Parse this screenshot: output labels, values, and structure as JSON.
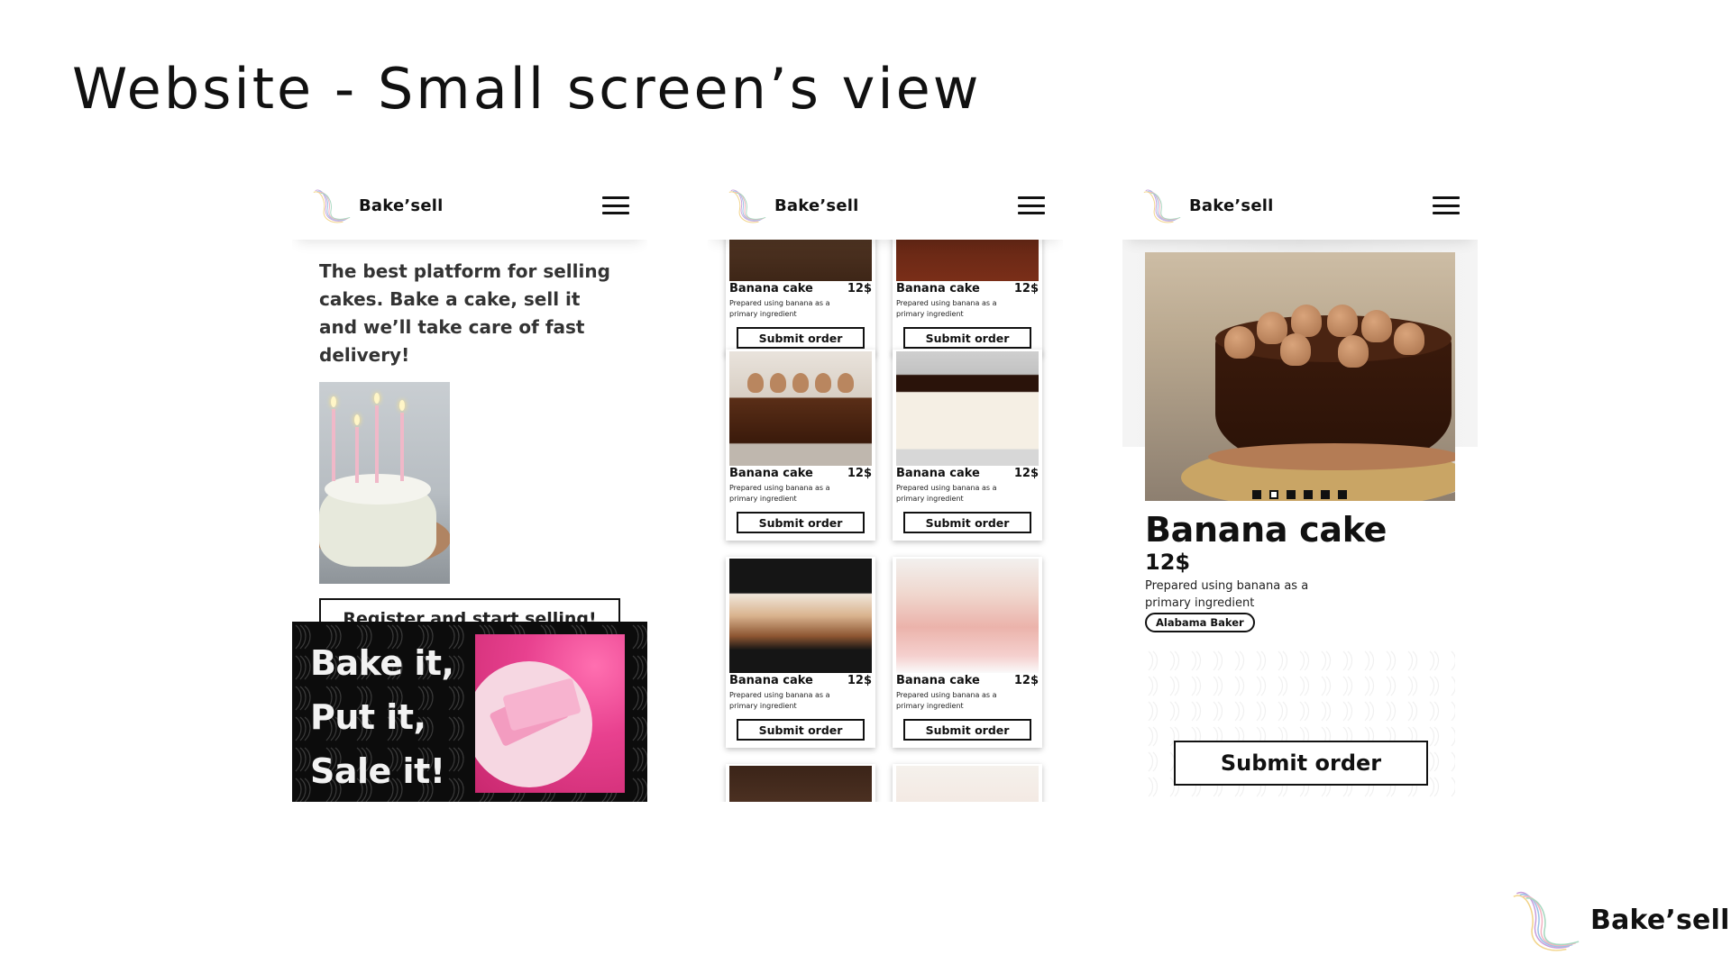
{
  "slide": {
    "title": "Website - Small screen’s view"
  },
  "brand": {
    "name": "Bake’sell",
    "logo_icon": "wave-logo-icon",
    "menu_icon": "hamburger-menu-icon"
  },
  "home": {
    "hero_text": "The best platform for selling cakes. Bake a cake, sell it and we’ll take care of fast delivery!",
    "register_label": "Register and start selling!",
    "promo_lines": [
      "Bake it,",
      "Put it,",
      "Sale it!"
    ]
  },
  "listing": {
    "cards": [
      {
        "name": "Banana cake",
        "price": "12$",
        "desc": "Prepared using banana as a primary ingredient",
        "button": "Submit order"
      },
      {
        "name": "Banana cake",
        "price": "12$",
        "desc": "Prepared using banana as a primary ingredient",
        "button": "Submit order"
      },
      {
        "name": "Banana cake",
        "price": "12$",
        "desc": "Prepared using banana as a primary ingredient",
        "button": "Submit order"
      },
      {
        "name": "Banana cake",
        "price": "12$",
        "desc": "Prepared using banana as a primary ingredient",
        "button": "Submit order"
      },
      {
        "name": "Banana cake",
        "price": "12$",
        "desc": "Prepared using banana as a primary ingredient",
        "button": "Submit order"
      },
      {
        "name": "Banana cake",
        "price": "12$",
        "desc": "Prepared using banana as a primary ingredient",
        "button": "Submit order"
      }
    ]
  },
  "detail": {
    "title": "Banana cake",
    "price": "12$",
    "desc": "Prepared using banana as a primary ingredient",
    "baker": "Alabama Baker",
    "submit_label": "Submit order",
    "carousel": {
      "count": 6,
      "active_index": 1
    }
  }
}
